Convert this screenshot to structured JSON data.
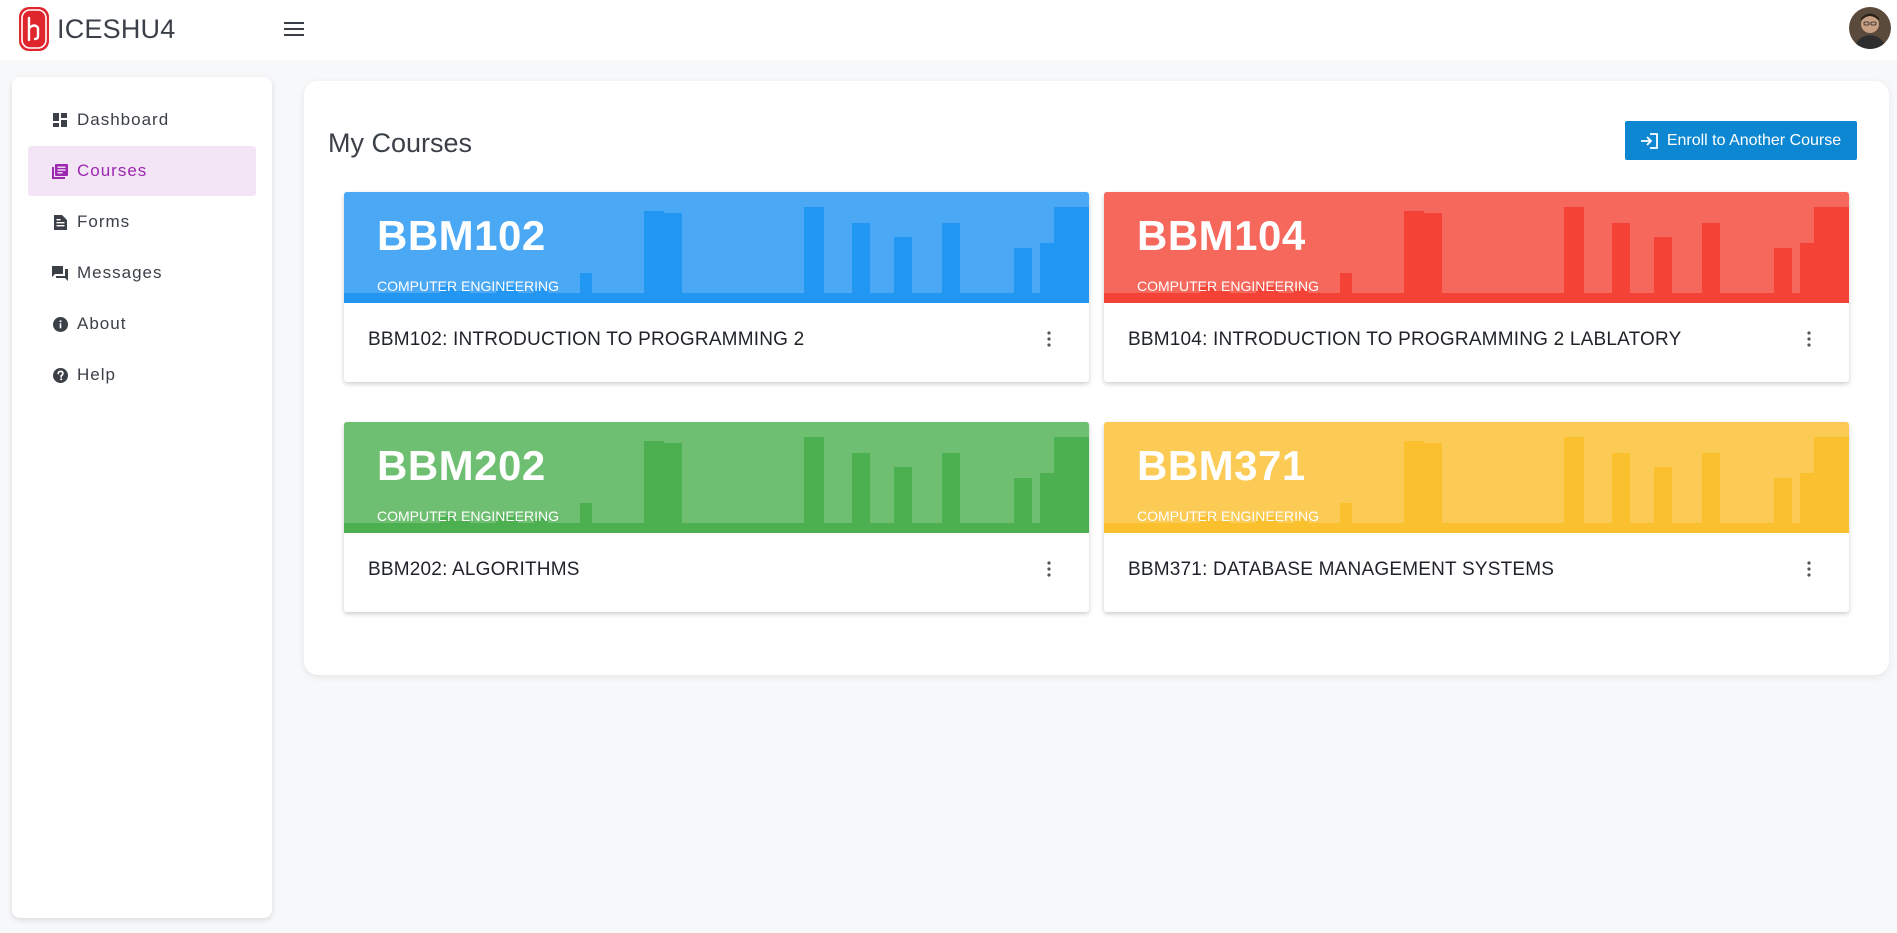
{
  "app": {
    "name": "ICESHU4",
    "logo_icon": "hacettepe-logo",
    "menu_icon": "hamburger-menu-icon",
    "avatar_icon": "user-avatar"
  },
  "sidebar": {
    "items": [
      {
        "label": "Dashboard",
        "icon": "dashboard-icon",
        "active": false
      },
      {
        "label": "Courses",
        "icon": "courses-icon",
        "active": true
      },
      {
        "label": "Forms",
        "icon": "forms-icon",
        "active": false
      },
      {
        "label": "Messages",
        "icon": "messages-icon",
        "active": false
      },
      {
        "label": "About",
        "icon": "info-icon",
        "active": false
      },
      {
        "label": "Help",
        "icon": "help-icon",
        "active": false
      }
    ]
  },
  "main": {
    "title": "My Courses",
    "enroll_button": {
      "label": "Enroll to Another Course",
      "icon": "login-arrow-icon"
    },
    "courses": [
      {
        "code": "BBM102",
        "department": "COMPUTER ENGINEERING",
        "title": "BBM102: INTRODUCTION TO PROGRAMMING 2",
        "color": "#2196f3",
        "light": "#4ba8f5"
      },
      {
        "code": "BBM104",
        "department": "COMPUTER ENGINEERING",
        "title": "BBM104: INTRODUCTION TO PROGRAMMING 2 LABLATORY",
        "color": "#f44336",
        "light": "#f6675c"
      },
      {
        "code": "BBM202",
        "department": "COMPUTER ENGINEERING",
        "title": "BBM202: ALGORITHMS",
        "color": "#4caf50",
        "light": "#6fbf72"
      },
      {
        "code": "BBM371",
        "department": "COMPUTER ENGINEERING",
        "title": "BBM371: DATABASE MANAGEMENT SYSTEMS",
        "color": "#fbc02d",
        "light": "#fccb56"
      }
    ]
  }
}
